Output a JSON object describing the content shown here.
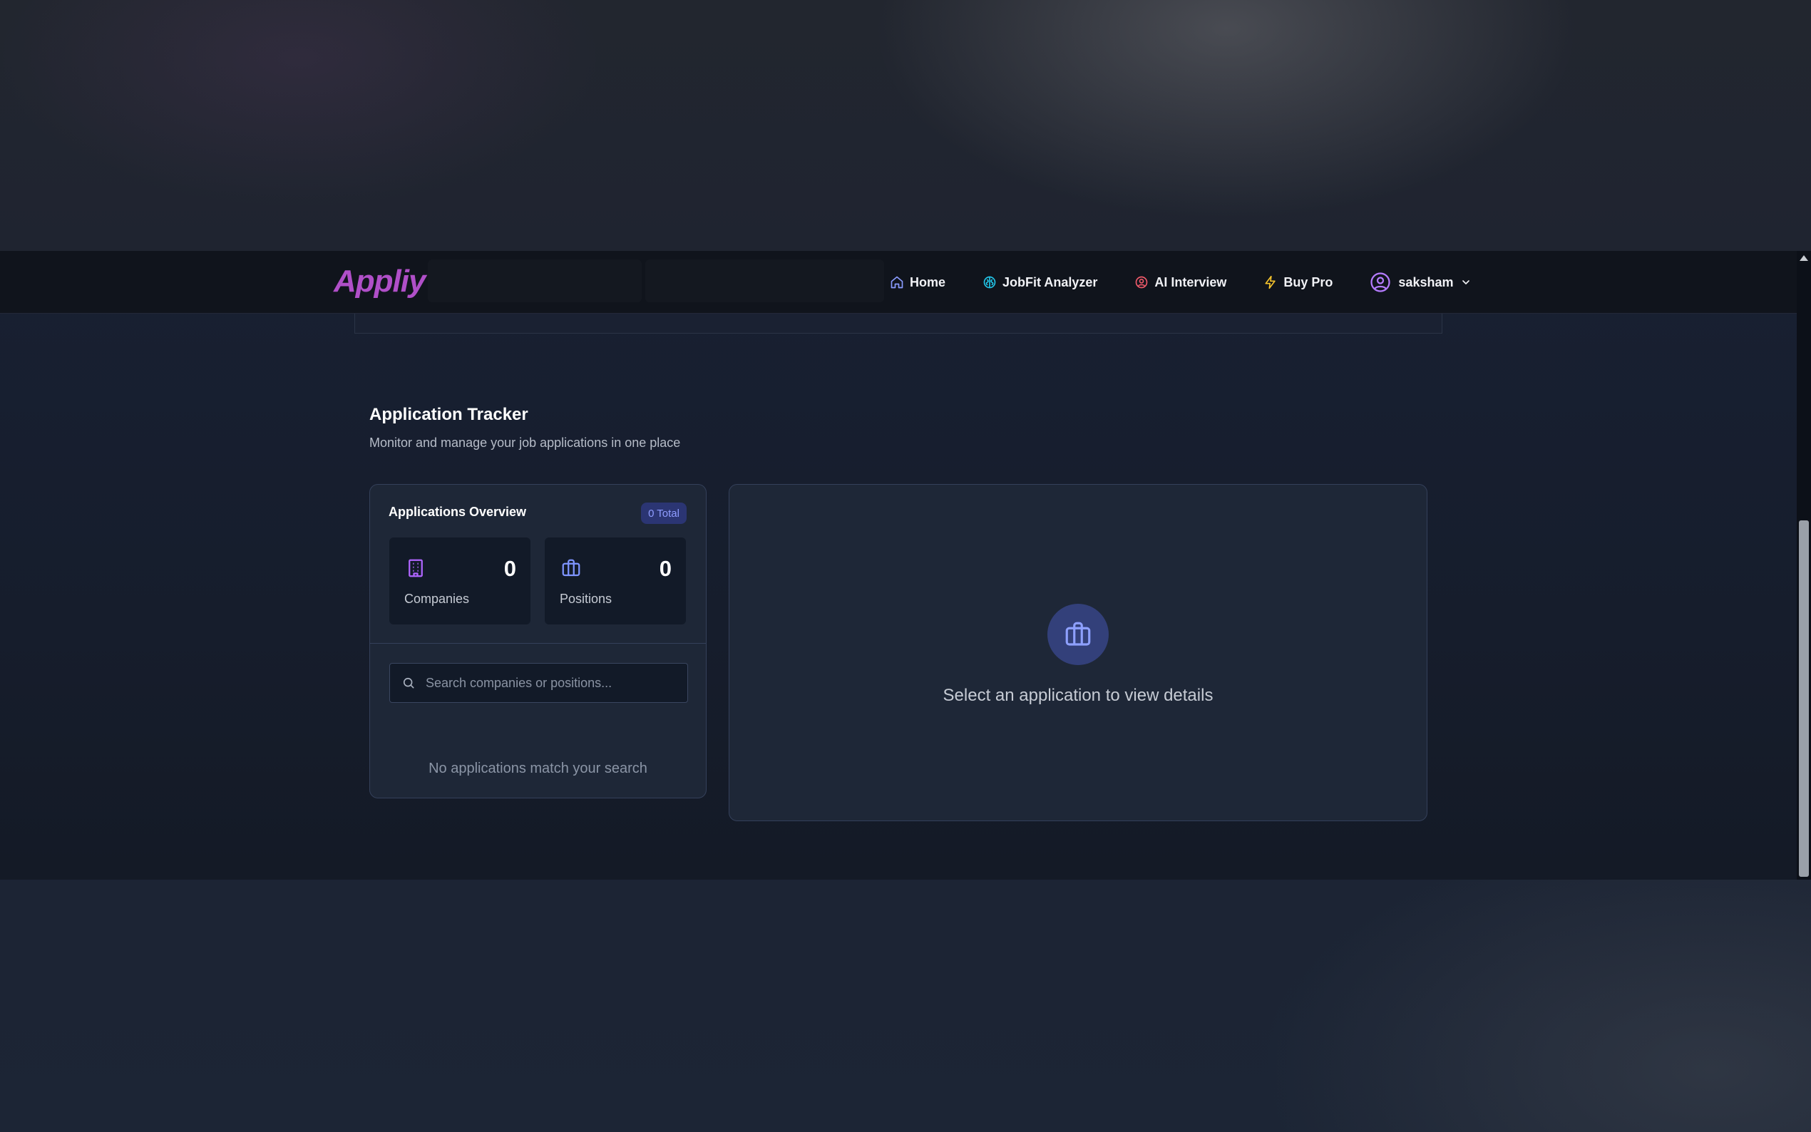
{
  "brand": {
    "logo_text": "Appliy",
    "logo_color": "#b04fc8"
  },
  "nav": {
    "items": [
      {
        "label": "Home",
        "icon": "home-icon",
        "color": "#8a9cff"
      },
      {
        "label": "JobFit Analyzer",
        "icon": "brain-icon",
        "color": "#22c4e6"
      },
      {
        "label": "AI Interview",
        "icon": "bot-icon",
        "color": "#f05a6a"
      },
      {
        "label": "Buy Pro",
        "icon": "zap-icon",
        "color": "#f5c32c"
      }
    ],
    "user": {
      "name": "saksham",
      "icon": "user-circle-icon",
      "color": "#b57cff"
    }
  },
  "tracker": {
    "title": "Application Tracker",
    "subtitle": "Monitor and manage your job applications in one place"
  },
  "overview": {
    "title": "Applications Overview",
    "total_badge": "0 Total",
    "stats": [
      {
        "label": "Companies",
        "value": "0",
        "icon": "building-icon",
        "color": "#b065ff"
      },
      {
        "label": "Positions",
        "value": "0",
        "icon": "briefcase-icon",
        "color": "#7f95ff"
      }
    ],
    "search": {
      "placeholder": "Search companies or positions...",
      "value": ""
    },
    "empty_message": "No applications match your search"
  },
  "details": {
    "icon": "briefcase-icon",
    "empty_message": "Select an application to view details"
  }
}
